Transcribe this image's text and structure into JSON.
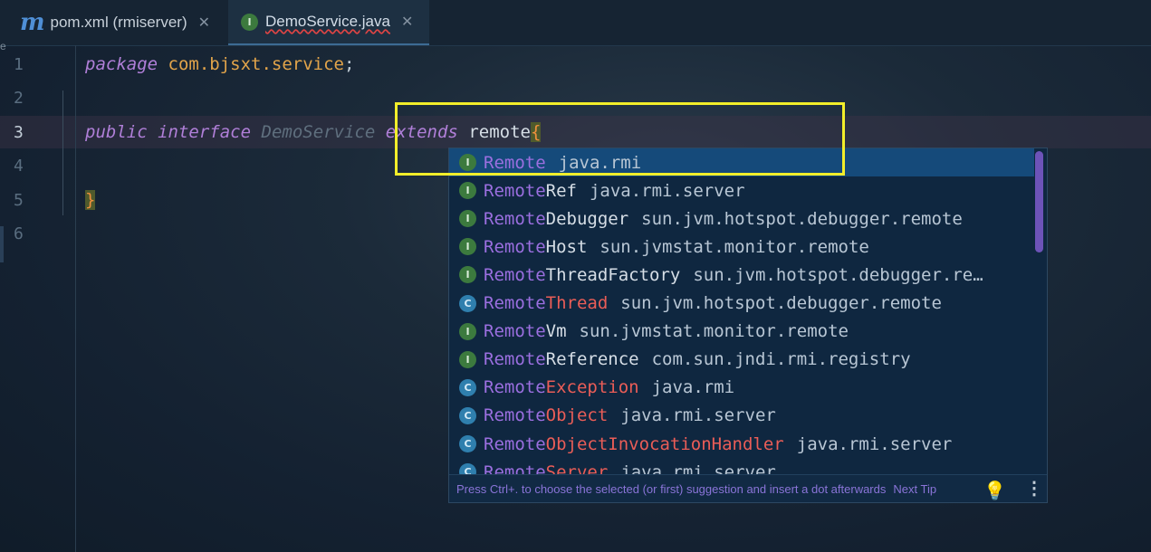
{
  "tabs": [
    {
      "label": "pom.xml (rmiserver)",
      "icon": "maven-icon"
    },
    {
      "label": "DemoService.java",
      "icon": "interface-icon",
      "active": true
    }
  ],
  "gutter": {
    "edge_char": "e",
    "line_numbers": [
      "1",
      "2",
      "3",
      "4",
      "5",
      "6"
    ],
    "active_line": "3"
  },
  "code": {
    "line1": {
      "keyword": "package",
      "pkg": "com.bjsxt.service",
      "semi": ";"
    },
    "line3": {
      "kw1": "public",
      "kw2": "interface",
      "name": "DemoService",
      "kw3": "extends",
      "typed": "remote",
      "brace": "{"
    },
    "line5": {
      "brace": "}"
    }
  },
  "completion": {
    "items": [
      {
        "kind": "I",
        "match": "Remote",
        "rest": "",
        "pkg": "java.rmi",
        "selected": true
      },
      {
        "kind": "I",
        "match": "Remote",
        "rest": "Ref",
        "pkg": "java.rmi.server"
      },
      {
        "kind": "I",
        "match": "Remote",
        "rest": "Debugger",
        "pkg": "sun.jvm.hotspot.debugger.remote"
      },
      {
        "kind": "I",
        "match": "Remote",
        "rest": "Host",
        "pkg": "sun.jvmstat.monitor.remote"
      },
      {
        "kind": "I",
        "match": "Remote",
        "rest": "ThreadFactory",
        "pkg": "sun.jvm.hotspot.debugger.re…"
      },
      {
        "kind": "C",
        "match": "Remote",
        "rest": "Thread",
        "pkg": "sun.jvm.hotspot.debugger.remote"
      },
      {
        "kind": "I",
        "match": "Remote",
        "rest": "Vm",
        "pkg": "sun.jvmstat.monitor.remote"
      },
      {
        "kind": "I",
        "match": "Remote",
        "rest": "Reference",
        "pkg": "com.sun.jndi.rmi.registry"
      },
      {
        "kind": "C",
        "match": "Remote",
        "rest": "Exception",
        "pkg": "java.rmi"
      },
      {
        "kind": "C",
        "match": "Remote",
        "rest": "Object",
        "pkg": "java.rmi.server"
      },
      {
        "kind": "C",
        "match": "Remote",
        "rest": "ObjectInvocationHandler",
        "pkg": "java.rmi.server"
      },
      {
        "kind": "C",
        "match": "Remote",
        "rest": "Server",
        "pkg": "java.rmi.server"
      }
    ],
    "footer_hint": "Press Ctrl+. to choose the selected (or first) suggestion and insert a dot afterwards",
    "next_tip": "Next Tip"
  },
  "colors": {
    "highlight_box": "#f2ee2a",
    "keyword": "#b07fd8",
    "package": "#e2a44a",
    "match": "#9b6fe0"
  }
}
